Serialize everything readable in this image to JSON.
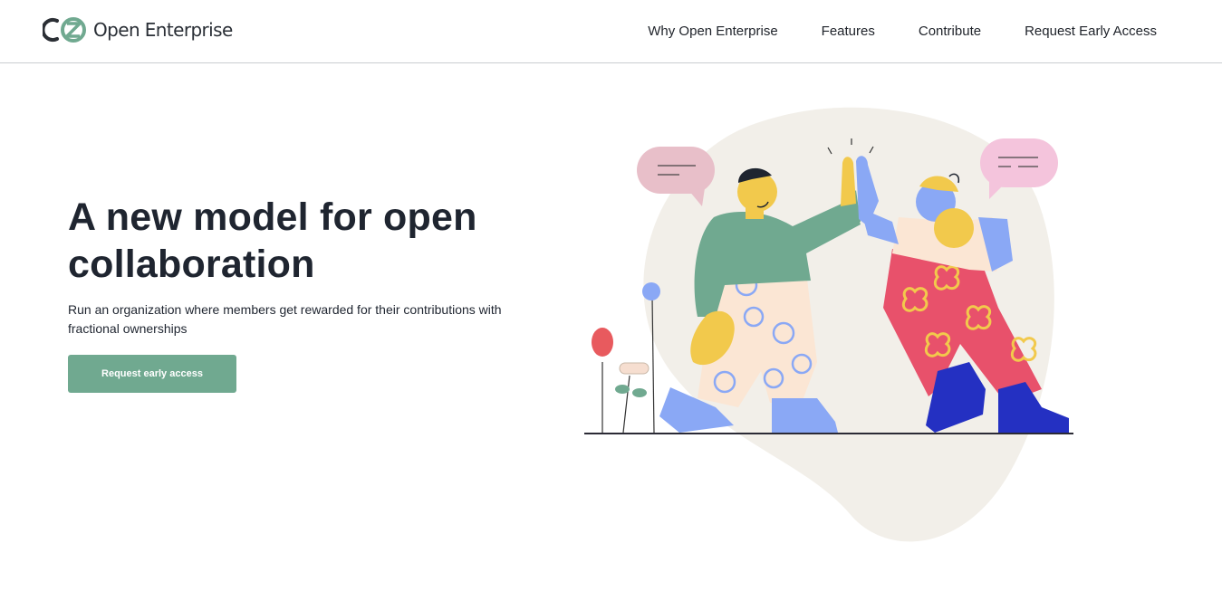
{
  "brand": {
    "name": "Open Enterprise",
    "accent": "#70a990"
  },
  "nav": {
    "items": [
      {
        "label": "Why Open Enterprise"
      },
      {
        "label": "Features"
      },
      {
        "label": "Contribute"
      },
      {
        "label": "Request Early Access"
      }
    ]
  },
  "hero": {
    "title": "A new model for open collaboration",
    "subtitle": "Run an organization where members get rewarded for their contributions with fractional ownerships",
    "cta_label": "Request early access",
    "illustration_icon": "high-five-illustration"
  }
}
